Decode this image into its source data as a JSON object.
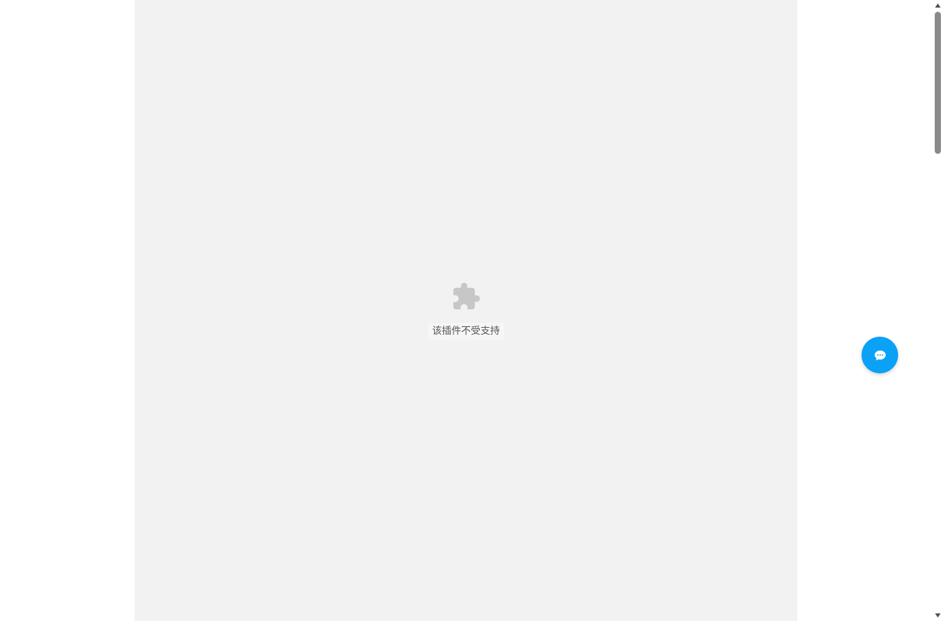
{
  "plugin": {
    "message": "该插件不受支持",
    "icon": "puzzle-piece-icon"
  },
  "chat_button": {
    "icon": "chat-bubble-icon",
    "color": "#0aa1f7"
  },
  "scrollbar": {
    "up_icon": "triangle-up-icon",
    "down_icon": "triangle-down-icon"
  }
}
